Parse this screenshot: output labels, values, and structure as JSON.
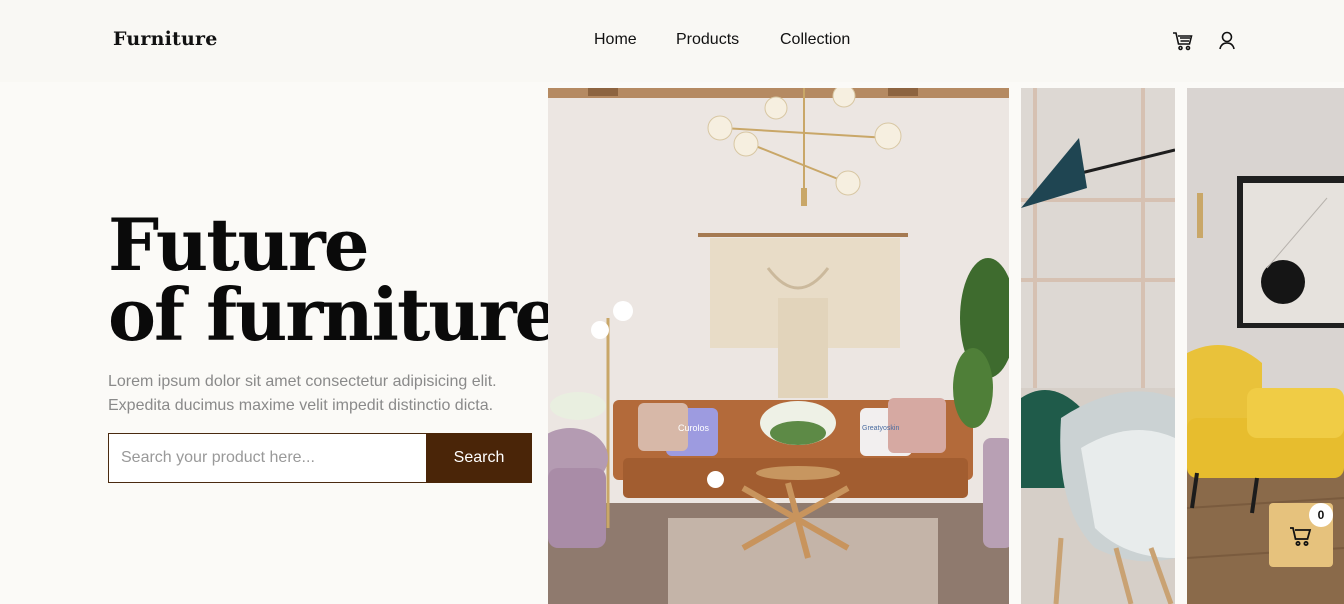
{
  "header": {
    "logo": "Furniture",
    "nav": [
      {
        "label": "Home"
      },
      {
        "label": "Products"
      },
      {
        "label": "Collection"
      }
    ],
    "icons": [
      "cart-icon",
      "user-icon"
    ]
  },
  "hero": {
    "title_line1": "Future",
    "title_line2": "of furniture",
    "description": "Lorem ipsum dolor sit amet consectetur adipisicing elit. Expedita ducimus maxime velit impedit distinctio dicta.",
    "search": {
      "placeholder": "Search your product here...",
      "button_label": "Search"
    }
  },
  "gallery": {
    "pillows": [
      "Curolos",
      "Greatyoskin"
    ]
  },
  "floating_cart": {
    "count": "0",
    "icon": "cart-icon"
  },
  "colors": {
    "accent_brown": "#4a2508",
    "cart_bg": "#e6c27d",
    "background": "#fbfaf7"
  }
}
